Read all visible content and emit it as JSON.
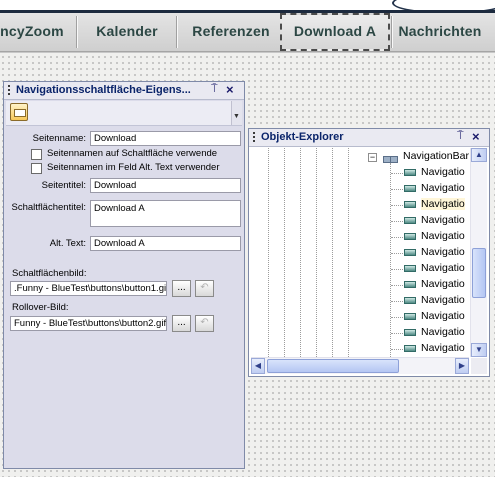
{
  "navbar": {
    "items": [
      {
        "label": "ncyZoom"
      },
      {
        "label": "Kalender"
      },
      {
        "label": "Referenzen"
      },
      {
        "label": "Download A",
        "selected": true
      },
      {
        "label": "Nachrichten"
      }
    ]
  },
  "props_panel": {
    "title": "Navigationsschaltfläche-Eigens...",
    "pin_glyph": "⍑",
    "close_glyph": "×",
    "fields": {
      "seitenname_label": "Seitenname:",
      "seitenname_value": "Download",
      "check1_label": "Seitennamen auf Schaltfläche verwende",
      "check2_label": "Seitennamen im Feld Alt. Text verwender",
      "seitentitel_label": "Seitentitel:",
      "seitentitel_value": "Download",
      "schaltflaechentitel_label": "Schaltflächentitel:",
      "schaltflaechentitel_value": "Download A",
      "alt_text_label": "Alt. Text:",
      "alt_text_value": "Download A",
      "schaltflaechenbild_label": "Schaltflächenbild:",
      "schaltflaechenbild_value": ".Funny - BlueTest\\buttons\\button1.gif",
      "rollover_label": "Rollover-Bild:",
      "rollover_value": "Funny - BlueTest\\buttons\\button2.gif",
      "browse_label": "...",
      "reset_glyph": "↶"
    }
  },
  "explorer_panel": {
    "title": "Objekt-Explorer",
    "pin_glyph": "⍑",
    "close_glyph": "×",
    "tree": {
      "parent_label": "NavigationBar",
      "children": [
        "Navigatio",
        "Navigatio",
        "Navigatio",
        "Navigatio",
        "Navigatio",
        "Navigatio",
        "Navigatio",
        "Navigatio",
        "Navigatio",
        "Navigatio",
        "Navigatio",
        "Navigatio"
      ]
    },
    "scroll_up": "▲",
    "scroll_down": "▼",
    "scroll_left": "◀",
    "scroll_right": "▶"
  }
}
